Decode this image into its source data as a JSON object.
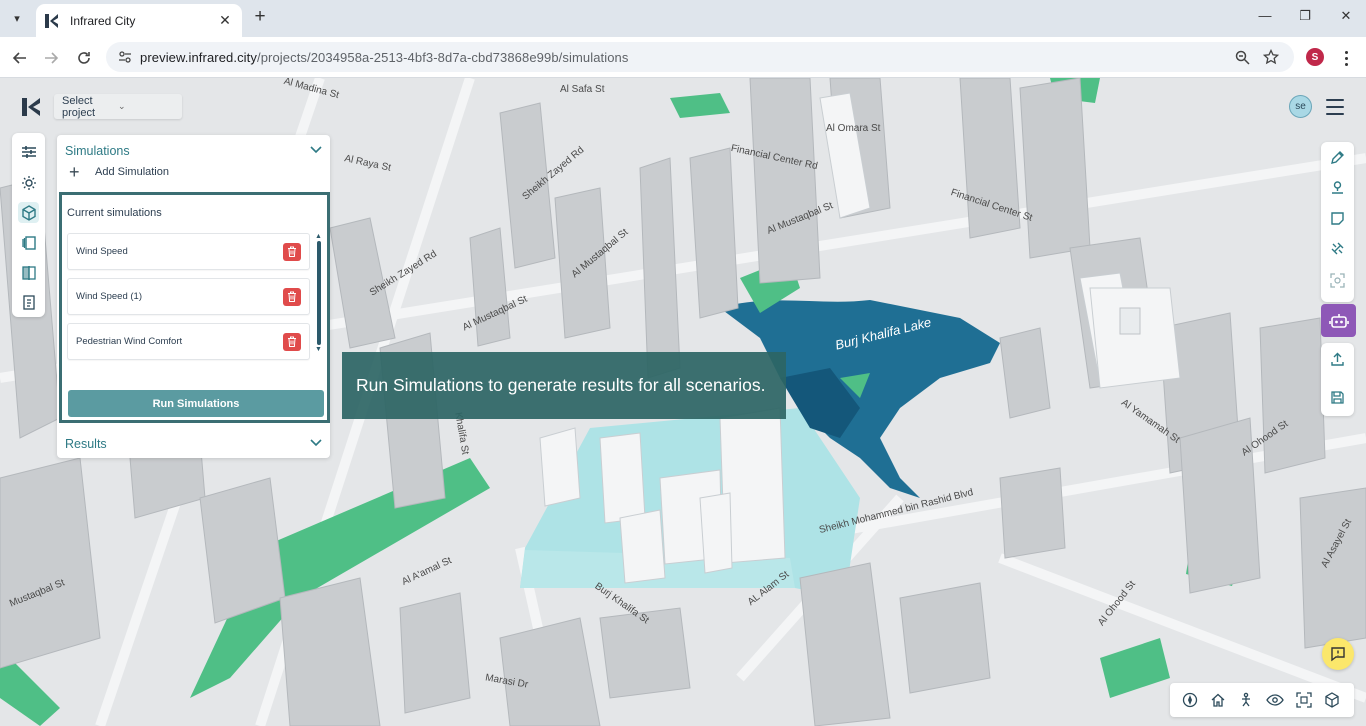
{
  "browser": {
    "tab_title": "Infrared City",
    "url_host": "preview.infrared.city",
    "url_path": "/projects/2034958a-2513-4bf3-8d7a-cbd73868e99b/simulations",
    "profile_initial": "S"
  },
  "app": {
    "project_select": "Select project",
    "user_initials": "se",
    "simulations_header": "Simulations",
    "add_simulation": "Add Simulation",
    "current_simulations_title": "Current simulations",
    "simulations": [
      {
        "name": "Wind Speed"
      },
      {
        "name": "Wind Speed (1)"
      },
      {
        "name": "Pedestrian Wind Comfort"
      }
    ],
    "run_button": "Run Simulations",
    "results_header": "Results",
    "tooltip": "Run Simulations to generate results for all scenarios."
  },
  "map": {
    "lake_label": "Burj Khalifa Lake",
    "streets": [
      "Al Safa St",
      "Al Madina St",
      "Al Omara St",
      "Financial Center Rd",
      "Financial Center St",
      "Al Mustaqbal St",
      "Sheikh Zayed Rd",
      "Al Raya St",
      "Al Mustaqbal St",
      "Al Mustaqbal St",
      "Al Mustaqbal St",
      "Sheikh Zayed Rd",
      "Khalifa St",
      "Al Yamamah St",
      "Al Ohood St",
      "Sheikh Mohammed bin Rashid Blvd",
      "Al A'amal St",
      "Burj Khalifa St",
      "AL Alam St",
      "Al Ohood St",
      "Marasi Dr",
      "Al Asayel St",
      "Mustaqbal St"
    ]
  },
  "icons": {
    "left_rail": [
      "sliders-icon",
      "sun-icon",
      "cube-icon",
      "layers-icon",
      "compare-icon",
      "clipboard-icon"
    ],
    "right_rail": [
      "pencil-icon",
      "location-icon",
      "area-icon",
      "satellite-icon",
      "scan-icon"
    ],
    "utility": [
      "upload-icon",
      "save-icon"
    ],
    "bottom_bar": [
      "compass-icon",
      "home-icon",
      "person-icon",
      "eye-icon",
      "fit-icon",
      "3d-cube-icon"
    ]
  },
  "colors": {
    "brand": "#2e7a85",
    "run_button": "#5b9ba1",
    "panel_border": "#3b6e73",
    "tooltip_bg": "#2d6564",
    "delete": "#e04b4b",
    "lake": "#1f6f94",
    "plaza": "#aee3e6",
    "park": "#4fbf86",
    "ai_button": "#8e58b7",
    "feedback": "#fbe76b"
  }
}
